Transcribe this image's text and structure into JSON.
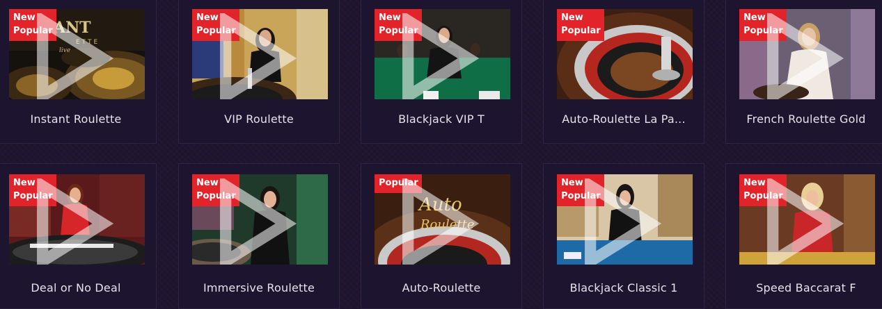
{
  "games": [
    {
      "title": "Instant Roulette",
      "badges": [
        "New",
        "Popular"
      ]
    },
    {
      "title": "VIP Roulette",
      "badges": [
        "New",
        "Popular"
      ]
    },
    {
      "title": "Blackjack VIP T",
      "badges": [
        "New",
        "Popular"
      ]
    },
    {
      "title": "Auto-Roulette La Pa...",
      "badges": [
        "New",
        "Popular"
      ]
    },
    {
      "title": "French Roulette Gold",
      "badges": [
        "New",
        "Popular"
      ]
    },
    {
      "title": "Deal or No Deal",
      "badges": [
        "New",
        "Popular"
      ]
    },
    {
      "title": "Immersive Roulette",
      "badges": [
        "New",
        "Popular"
      ]
    },
    {
      "title": "Auto-Roulette",
      "badges": [
        "Popular"
      ],
      "thumb_text": [
        "Auto",
        "Roulette"
      ]
    },
    {
      "title": "Blackjack Classic 1",
      "badges": [
        "New",
        "Popular"
      ]
    },
    {
      "title": "Speed Baccarat F",
      "badges": [
        "New",
        "Popular"
      ]
    }
  ],
  "thumb_overlay": {
    "instant": [
      "ANT",
      "ETTE",
      "live"
    ]
  },
  "colors": {
    "badge": "#e3232a",
    "background": "#1f1530",
    "card_border": "#2f2443",
    "title_text": "#e6e3ec"
  }
}
